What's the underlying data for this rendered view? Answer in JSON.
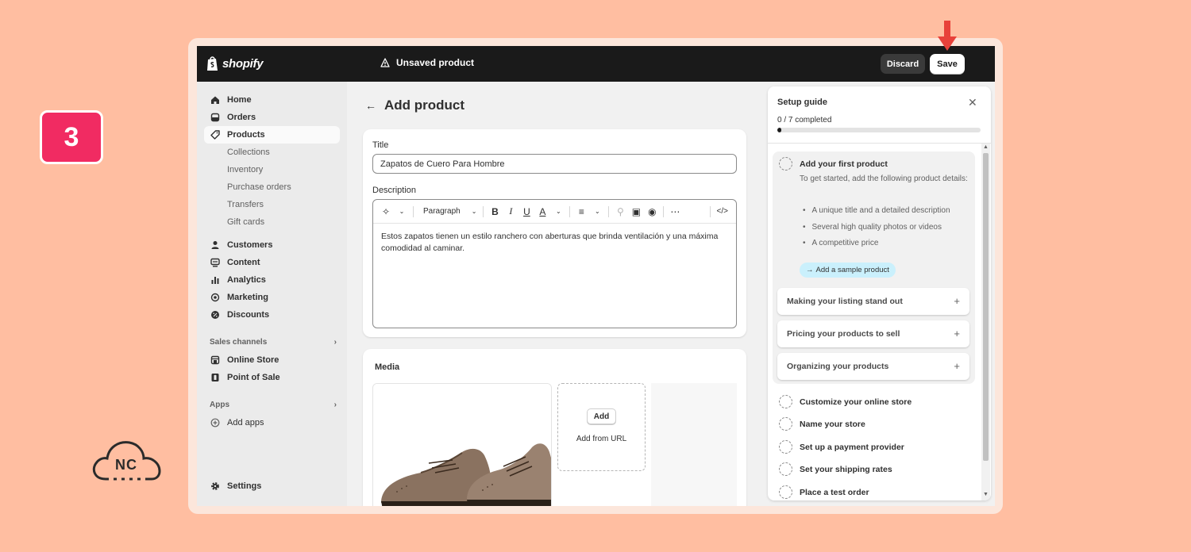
{
  "step_badge": "3",
  "brand_logo_text": "NC",
  "topbar": {
    "logo_text": "shopify",
    "status_text": "Unsaved product",
    "discard_label": "Discard",
    "save_label": "Save"
  },
  "sidebar": {
    "items": [
      {
        "label": "Home",
        "icon": "home-icon"
      },
      {
        "label": "Orders",
        "icon": "orders-icon"
      },
      {
        "label": "Products",
        "icon": "tag-icon",
        "active": true
      }
    ],
    "product_subitems": [
      "Collections",
      "Inventory",
      "Purchase orders",
      "Transfers",
      "Gift cards"
    ],
    "items2": [
      {
        "label": "Customers",
        "icon": "person-icon"
      },
      {
        "label": "Content",
        "icon": "content-icon"
      },
      {
        "label": "Analytics",
        "icon": "bar-chart-icon"
      },
      {
        "label": "Marketing",
        "icon": "target-icon"
      },
      {
        "label": "Discounts",
        "icon": "discount-icon"
      }
    ],
    "sales_channels_label": "Sales channels",
    "channels": [
      {
        "label": "Online Store",
        "icon": "store-icon"
      },
      {
        "label": "Point of Sale",
        "icon": "pos-icon"
      }
    ],
    "apps_label": "Apps",
    "add_apps_label": "Add apps",
    "settings_label": "Settings"
  },
  "main": {
    "page_title": "Add product",
    "title_label": "Title",
    "title_value": "Zapatos de Cuero Para Hombre",
    "description_label": "Description",
    "paragraph_select": "Paragraph",
    "description_text": "Estos zapatos tienen un estilo ranchero con aberturas que brinda ventilación y una máxima comodidad al caminar.",
    "media_label": "Media",
    "add_button": "Add",
    "add_from_url": "Add from URL"
  },
  "setup_guide": {
    "title": "Setup guide",
    "progress_text": "0 / 7 completed",
    "progress_fraction": 0.02,
    "first_task": {
      "title": "Add your first product",
      "description": "To get started, add the following product details:",
      "bullets": [
        "A unique title and a detailed description",
        "Several high quality photos or videos",
        "A competitive price"
      ],
      "cta": "Add a sample product"
    },
    "accordions": [
      "Making your listing stand out",
      "Pricing your products to sell",
      "Organizing your products"
    ],
    "tasks": [
      "Customize your online store",
      "Name your store",
      "Set up a payment provider",
      "Set your shipping rates",
      "Place a test order"
    ]
  },
  "colors": {
    "page_background": "#FFBEA1",
    "badge": "#F12B62",
    "topbar": "#1A1A1A",
    "annotation_arrow": "#E8413A",
    "sample_cta_bg": "#CAF0FC"
  }
}
